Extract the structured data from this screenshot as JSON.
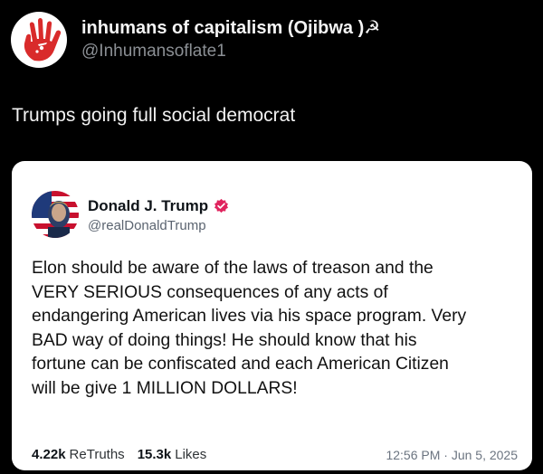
{
  "post": {
    "author": {
      "display_name": "inhumans of capitalism (Ojibwa )☭",
      "handle": "@Inhumansoflate1",
      "avatar_icon": "red-handprint-icon"
    },
    "text": "Trumps going full social democrat"
  },
  "quoted_post": {
    "author": {
      "display_name": "Donald J. Trump",
      "handle": "@realDonaldTrump",
      "avatar_icon": "flag-portrait-icon",
      "verified_icon": "verified-badge-icon"
    },
    "body": "Elon should be aware of the laws of treason and the\nVERY SERIOUS consequences of any acts of\nendangering American lives via his space program. Very\nBAD way of doing things! He should know that his\nfortune can be confiscated and each American Citizen\nwill be give 1 MILLION DOLLARS!",
    "stats": {
      "retruths_count": "4.22k",
      "retruths_label": "ReTruths",
      "likes_count": "15.3k",
      "likes_label": "Likes"
    },
    "timestamp": "12:56 PM · Jun 5, 2025"
  },
  "colors": {
    "background": "#000000",
    "card": "#ffffff",
    "handprint_red": "#d92b2b",
    "verified_pink": "#e0245e"
  }
}
